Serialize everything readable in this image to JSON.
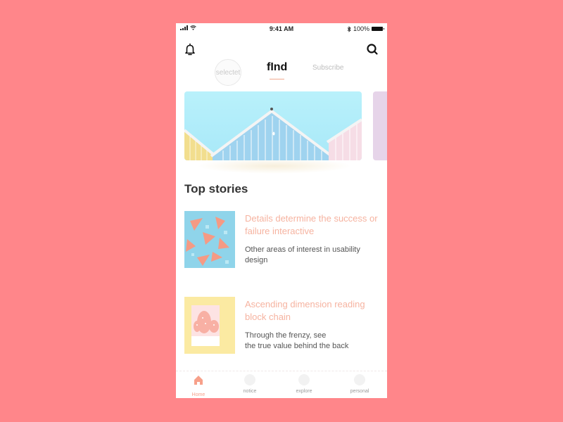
{
  "status_bar": {
    "time": "9:41 AM",
    "battery": "100%",
    "icons": [
      "signal-icon",
      "wifi-icon",
      "bluetooth-icon",
      "battery-icon"
    ]
  },
  "header": {
    "left_icon": "bell-icon",
    "right_icon": "search-icon"
  },
  "tabs": [
    {
      "label": "selectet",
      "active": false
    },
    {
      "label": "fInd",
      "active": true
    },
    {
      "label": "Subscribe",
      "active": false
    }
  ],
  "banner": {
    "description": "Pastel beach huts against a blue sky"
  },
  "section_title": "Top stories",
  "stories": [
    {
      "title": "Details determine the success or failure  interactive",
      "description": "Other areas of interest in usability design"
    },
    {
      "title": "Ascending dimension reading block chain",
      "description_line1": "Through the frenzy, see",
      "description_line2": "the true value behind the back"
    }
  ],
  "tabbar": [
    {
      "label": "Home",
      "icon": "home-icon",
      "active": true
    },
    {
      "label": "notice",
      "icon": "notice-icon",
      "active": false
    },
    {
      "label": "explore",
      "icon": "explore-icon",
      "active": false
    },
    {
      "label": "personal",
      "icon": "personal-icon",
      "active": false
    }
  ],
  "colors": {
    "background": "#ff868a",
    "accent": "#f6b3a0",
    "active_tab": "#f7a08a"
  }
}
